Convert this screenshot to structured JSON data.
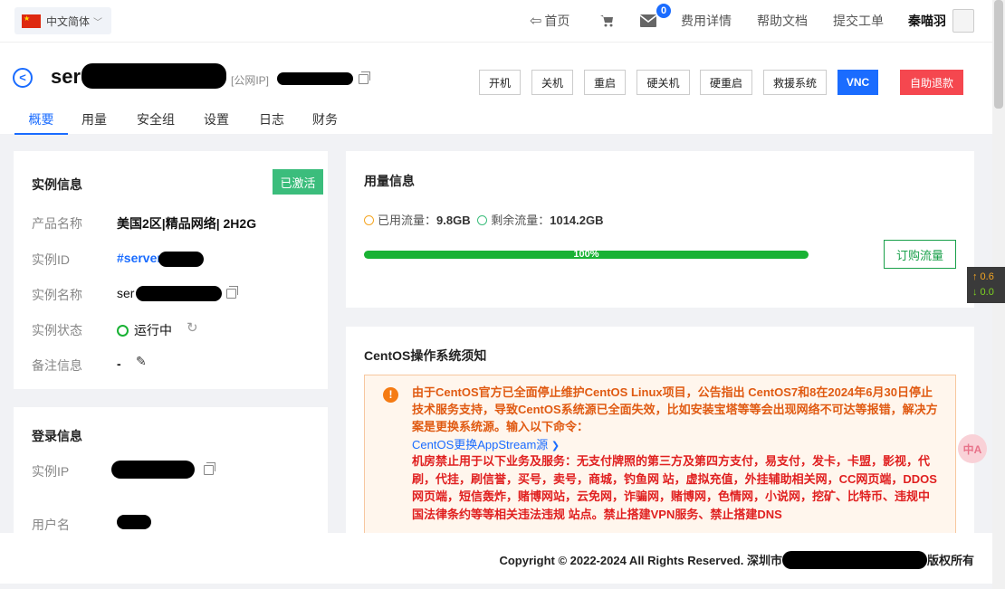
{
  "topbar": {
    "language": "中文简体",
    "nav": {
      "home": "首页",
      "cart_icon": "cart-icon",
      "messages_badge": "0",
      "billing": "费用详情",
      "docs": "帮助文档",
      "ticket": "提交工单",
      "username": "秦喵羽"
    }
  },
  "header": {
    "title_prefix": "ser",
    "ip_tag": "[公网IP]",
    "buttons": {
      "power_on": "开机",
      "power_off": "关机",
      "restart": "重启",
      "hard_off": "硬关机",
      "hard_restart": "硬重启",
      "rescue": "救援系统",
      "vnc": "VNC",
      "refund": "自助退款"
    },
    "tabs": [
      "概要",
      "用量",
      "安全组",
      "设置",
      "日志",
      "财务"
    ]
  },
  "instance": {
    "title": "实例信息",
    "status_badge": "已激活",
    "product_label": "产品名称",
    "product_value": "美国2区|精品网络| 2H2G",
    "id_label": "实例ID",
    "id_value": "#server",
    "name_label": "实例名称",
    "name_value": "ser",
    "state_label": "实例状态",
    "state_value": "运行中",
    "note_label": "备注信息",
    "note_value": "-"
  },
  "login": {
    "title": "登录信息",
    "ip_label": "实例IP",
    "user_label": "用户名"
  },
  "usage": {
    "title": "用量信息",
    "used_label": "已用流量：",
    "used_value": "9.8GB",
    "remain_label": "剩余流量：",
    "remain_value": "1014.2GB",
    "progress_text": "100%",
    "progress_fraction": 1.0,
    "buy_button": "订购流量",
    "used_color": "#f5a623",
    "remain_color": "#3bbd7c"
  },
  "notice": {
    "title": "CentOS操作系统须知",
    "text1": "由于CentOS官方已全面停止维护CentOS Linux项目，公告指出 CentOS7和8在2024年6月30日停止技术服务支持，导致CentOS系统源已全面失效，比如安装宝塔等等会出现网络不可达等报错，解决方案是更换系统源。输入以下命令：",
    "link": "CentOS更换AppStream源",
    "text2": "机房禁止用于以下业务及服务：无支付牌照的第三方及第四方支付，易支付，发卡，卡盟，影视，代刷，代挂，刷信誉，买号，卖号，商城，钓鱼网 站，虚拟充值，外挂辅助相关网，CC网页端，DDOS网页端，短信轰炸，赌博网站，云免网，诈骗网，赌博网，色情网，小说网，挖矿、比特币、违规中国法律条约等等相关违法违规 站点。禁止搭建VPN服务、禁止搭建DNS"
  },
  "footer": {
    "copyright": "Copyright © 2022-2024 All Rights Reserved. 深圳市",
    "suffix": "版权所有"
  },
  "widgets": {
    "speed_up": "↑ 0.6",
    "speed_down": "↓ 0.0",
    "translate": "中A"
  },
  "colors": {
    "accent": "#1a6cff",
    "success": "#19b234",
    "danger": "#f5474f",
    "warning": "#f57b13"
  }
}
